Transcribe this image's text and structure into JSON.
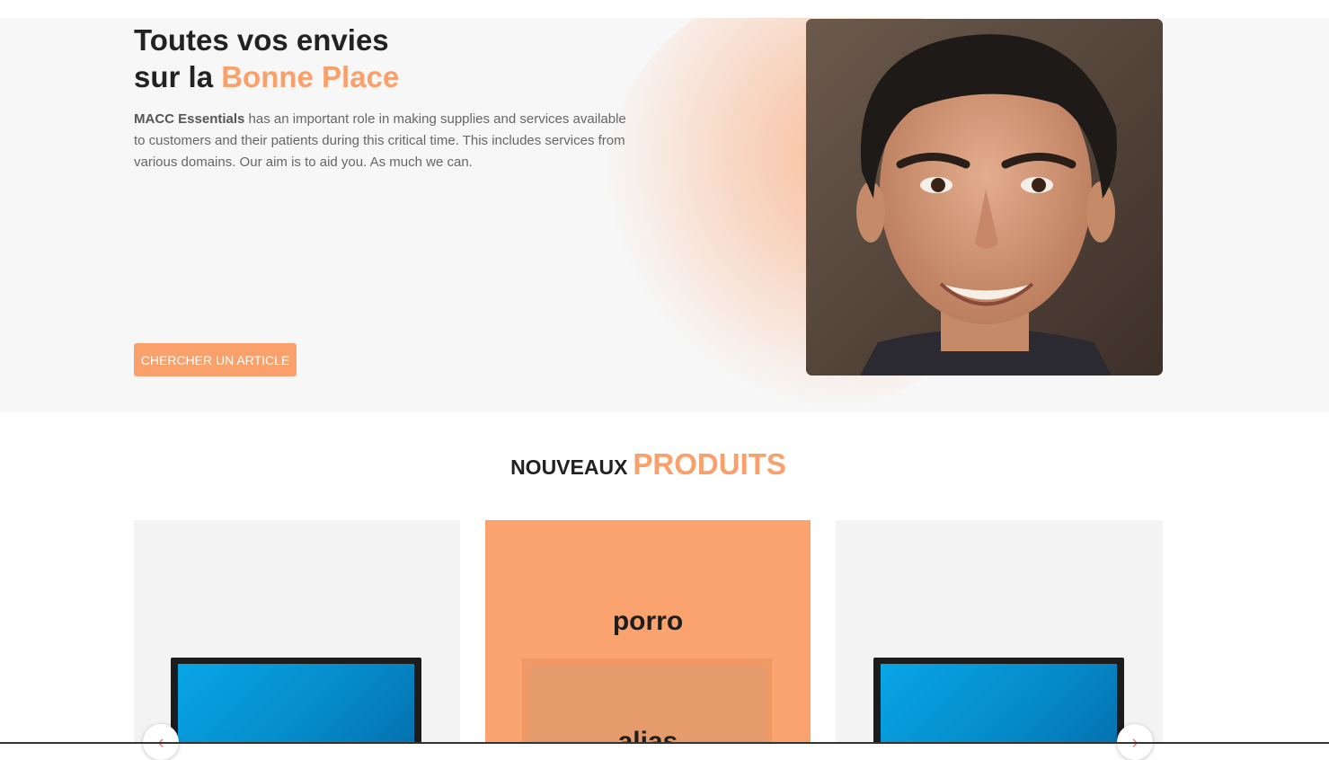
{
  "hero": {
    "title_line1": "Toutes vos envies",
    "title_line2_prefix": "sur la ",
    "title_line2_accent": "Bonne Place",
    "desc_bold": "MACC Essentials",
    "desc_rest": " has an important role in making supplies and services available to customers and their patients during this critical time. This includes services from various domains. Our aim is to aid you. As much we can.",
    "cta_label": "CHERCHER UN ARTICLE"
  },
  "products_section": {
    "title_part1": "NOUVEAUX",
    "title_part2": "PRODUITS",
    "cards": [
      {
        "kind": "monitor-image"
      },
      {
        "kind": "featured",
        "title": "porro",
        "subtitle": "alias"
      },
      {
        "kind": "monitor-image"
      }
    ],
    "prev_icon": "chevron-left-icon",
    "next_icon": "chevron-right-icon"
  },
  "colors": {
    "accent": "#f9a06b",
    "card_bg": "#f3f3f3",
    "featured_bg": "#fba36f"
  }
}
